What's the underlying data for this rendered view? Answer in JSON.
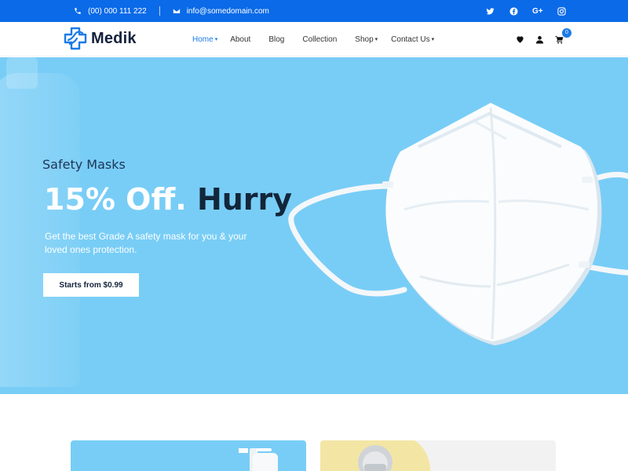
{
  "topbar": {
    "phone": "(00) 000 111 222",
    "email": "info@somedomain.com",
    "social": [
      "twitter-icon",
      "facebook-icon",
      "google-plus-icon",
      "instagram-icon"
    ],
    "gplus_label": "G+",
    "bg_color": "#0a6ae8"
  },
  "header": {
    "brand": "Medik",
    "nav": [
      {
        "label": "Home",
        "active": true,
        "dropdown": true
      },
      {
        "label": "About",
        "active": false,
        "dropdown": false
      },
      {
        "label": "Blog",
        "active": false,
        "dropdown": false
      },
      {
        "label": "Collection",
        "active": false,
        "dropdown": false
      },
      {
        "label": "Shop",
        "active": false,
        "dropdown": true
      },
      {
        "label": "Contact Us",
        "active": false,
        "dropdown": true
      }
    ],
    "cart_count": "0",
    "accent_color": "#1b7be6"
  },
  "hero": {
    "subtitle": "Safety Masks",
    "title_light": "15% Off.",
    "title_dark": "Hurry",
    "description": "Get the best Grade A safety mask for you & your loved ones protection.",
    "button_label": "Starts from $0.99",
    "bg_color": "#78cdf6"
  }
}
